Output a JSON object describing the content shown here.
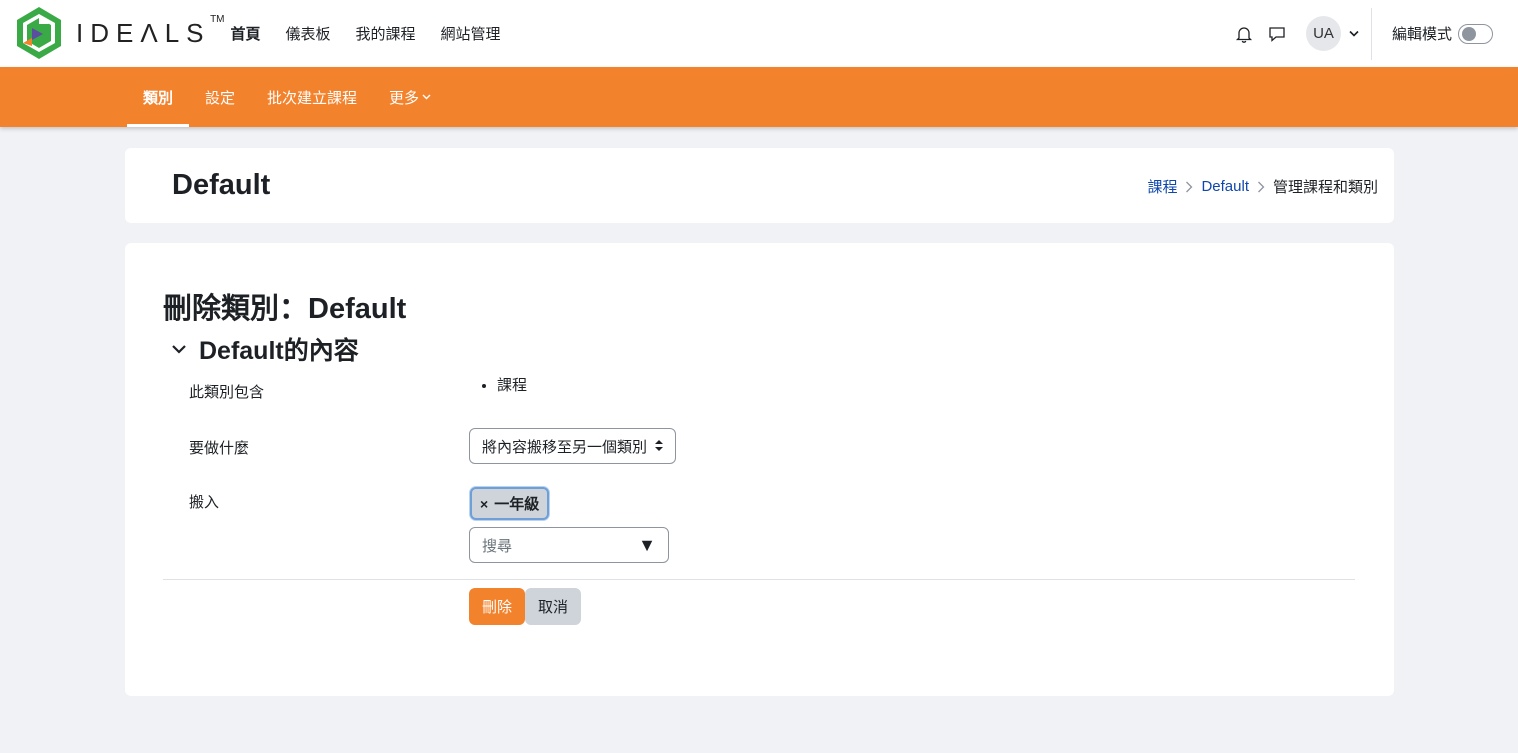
{
  "brand": {
    "name": "IDEΛLS",
    "tm": "TM"
  },
  "primary_nav": [
    "首頁",
    "儀表板",
    "我的課程",
    "網站管理"
  ],
  "user": {
    "initials": "UA"
  },
  "edit_mode": {
    "label": "編輯模式",
    "on": false
  },
  "secondary_nav": {
    "items": [
      "類別",
      "設定",
      "批次建立課程"
    ],
    "more": "更多"
  },
  "header": {
    "title": "Default",
    "breadcrumb": [
      "課程",
      "Default",
      "管理課程和類別"
    ]
  },
  "form": {
    "heading": "刪除類別：Default",
    "section_title": "Default的內容",
    "contains_label": "此類別包含",
    "contains_items": [
      "課程"
    ],
    "action_label": "要做什麼",
    "action_value": "將內容搬移至另一個類別",
    "move_to_label": "搬入",
    "selected_tag": "一年級",
    "search_placeholder": "搜尋",
    "delete_button": "刪除",
    "cancel_button": "取消"
  },
  "colors": {
    "accent": "#f3822d",
    "link": "#0f47ad"
  },
  "icons": [
    "bell-icon",
    "chat-icon",
    "chevron-down-icon",
    "chevron-right-icon",
    "sort-arrows-icon"
  ]
}
